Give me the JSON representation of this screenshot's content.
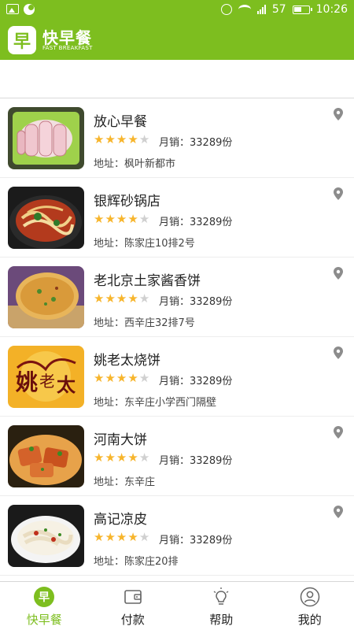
{
  "status_bar": {
    "battery_level": "57",
    "time": "10:26"
  },
  "app_bar": {
    "logo_glyph": "早",
    "title": "快早餐",
    "subtitle": "FAST BREAKFAST"
  },
  "rating_max": 5,
  "sales_prefix": "月销：",
  "address_prefix": "地址：",
  "restaurants": [
    {
      "name": "放心早餐",
      "rating": 4,
      "sales": "33289份",
      "address": "枫叶新都市",
      "thumb_icon": "pork-roll-plate-image"
    },
    {
      "name": "银辉砂锅店",
      "rating": 4,
      "sales": "33289份",
      "address": "陈家庄10排2号",
      "thumb_icon": "noodle-claypot-image"
    },
    {
      "name": "老北京土家酱香饼",
      "rating": 4,
      "sales": "33289份",
      "address": "西辛庄32排7号",
      "thumb_icon": "sauce-pancake-image"
    },
    {
      "name": "姚老太烧饼",
      "rating": 4,
      "sales": "33289份",
      "address": "东辛庄小学西门隔壁",
      "thumb_icon": "yao-laotai-logo-image"
    },
    {
      "name": "河南大饼",
      "rating": 4,
      "sales": "33289份",
      "address": "东辛庄",
      "thumb_icon": "flatbread-dish-image"
    },
    {
      "name": "高记凉皮",
      "rating": 4,
      "sales": "33289份",
      "address": "陈家庄20排",
      "thumb_icon": "liangpi-noodle-image"
    }
  ],
  "tabs": [
    {
      "label": "快早餐",
      "icon": "breakfast-icon",
      "active": true
    },
    {
      "label": "付款",
      "icon": "wallet-icon",
      "active": false
    },
    {
      "label": "帮助",
      "icon": "lightbulb-icon",
      "active": false
    },
    {
      "label": "我的",
      "icon": "user-icon",
      "active": false
    }
  ],
  "colors": {
    "brand_green": "#7dbe1f",
    "star_on": "#f7b52c",
    "star_off": "#d0d0d0"
  }
}
